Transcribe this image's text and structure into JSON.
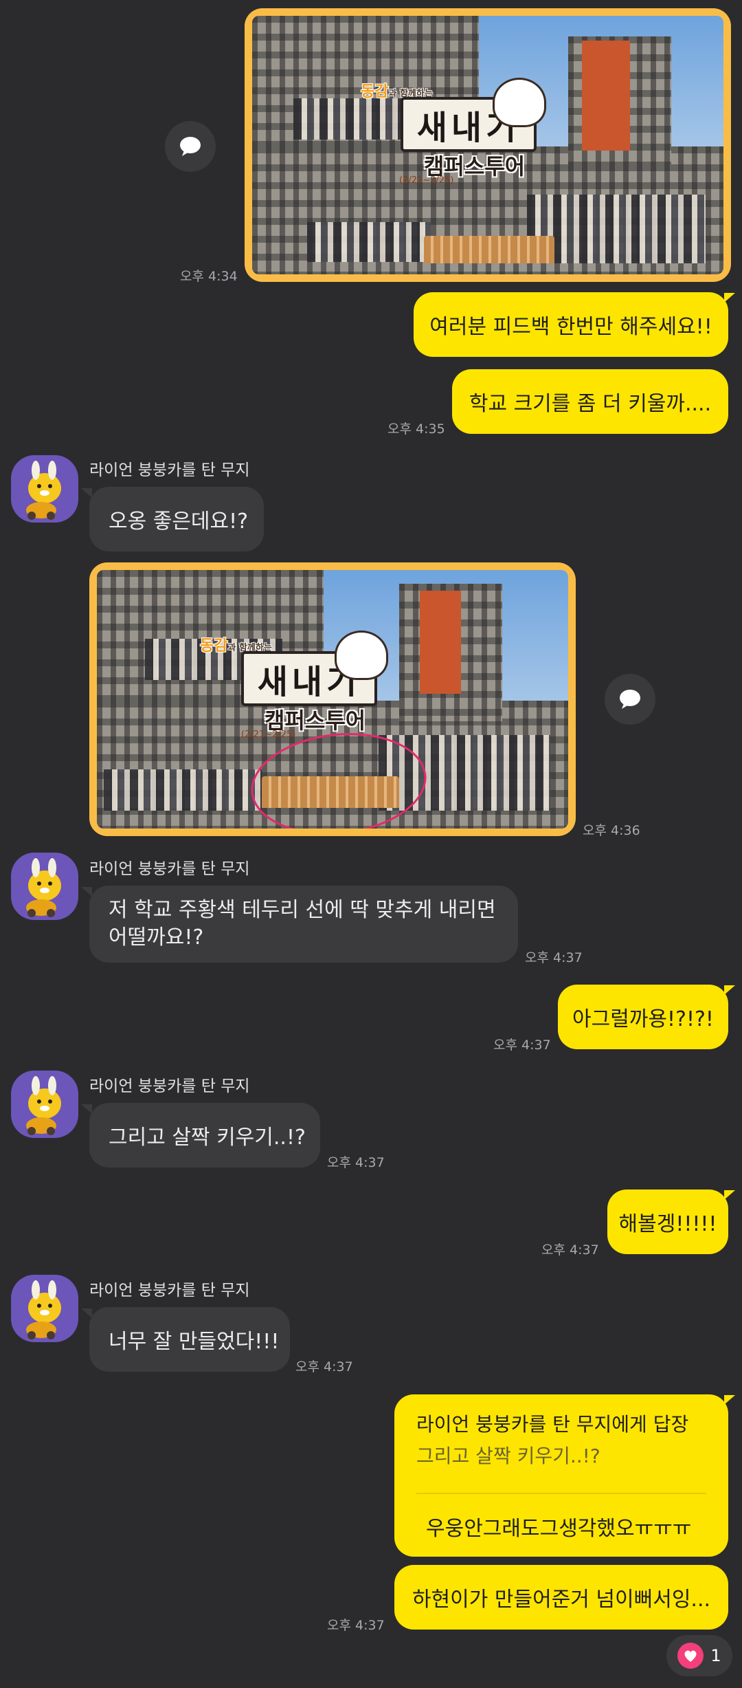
{
  "share_icon": "share-bubble-icon",
  "messages": {
    "m1": {
      "time": "오후 4:34"
    },
    "m2": {
      "text": "여러분 피드백 한번만 해주세요!!"
    },
    "m3": {
      "text": "학교 크기를 좀 더 키울까....",
      "time": "오후 4:35"
    },
    "m4": {
      "sender": "라이언 붕붕카를 탄 무지",
      "text": "오옹 좋은데요!?"
    },
    "m5": {
      "time": "오후 4:36"
    },
    "m6": {
      "sender": "라이언 붕붕카를 탄 무지",
      "line1": "저 학교 주황색 테두리 선에 딱 맞추게 내리면",
      "line2": "어떨까요!?",
      "time": "오후 4:37"
    },
    "m7": {
      "text": "아그럴까용!?!?!",
      "time": "오후 4:37"
    },
    "m8": {
      "sender": "라이언 붕붕카를 탄 무지",
      "text": "그리고 살짝 키우기..!?",
      "time": "오후 4:37"
    },
    "m9": {
      "text": "해볼겡!!!!!",
      "time": "오후 4:37"
    },
    "m10": {
      "sender": "라이언 붕붕카를 탄 무지",
      "text": "너무 잘 만들었다!!!",
      "time": "오후 4:37"
    },
    "m11": {
      "reply_to": "라이언 붕붕카를 탄 무지에게 답장",
      "quoted": "그리고 살짝 키우기..!?",
      "text": "우웅안그래도그생각했오ㅠㅠㅠ"
    },
    "m12": {
      "text": "하현이가 만들어준거 넘이뻐서잉...",
      "time": "오후 4:37"
    }
  },
  "poster": {
    "top": "동감",
    "top_small": "과 함께하는",
    "title": "새내기",
    "subtitle": "캠퍼스투어",
    "date": "(2/21~2/25)"
  },
  "reaction": {
    "icon": "heart-icon",
    "count": "1",
    "color": "#f43f7a"
  },
  "colors": {
    "my_bubble": "#fee500",
    "their_bubble": "#3b3b3e",
    "background": "#2b2b2d",
    "frame": "#f9bd47"
  }
}
